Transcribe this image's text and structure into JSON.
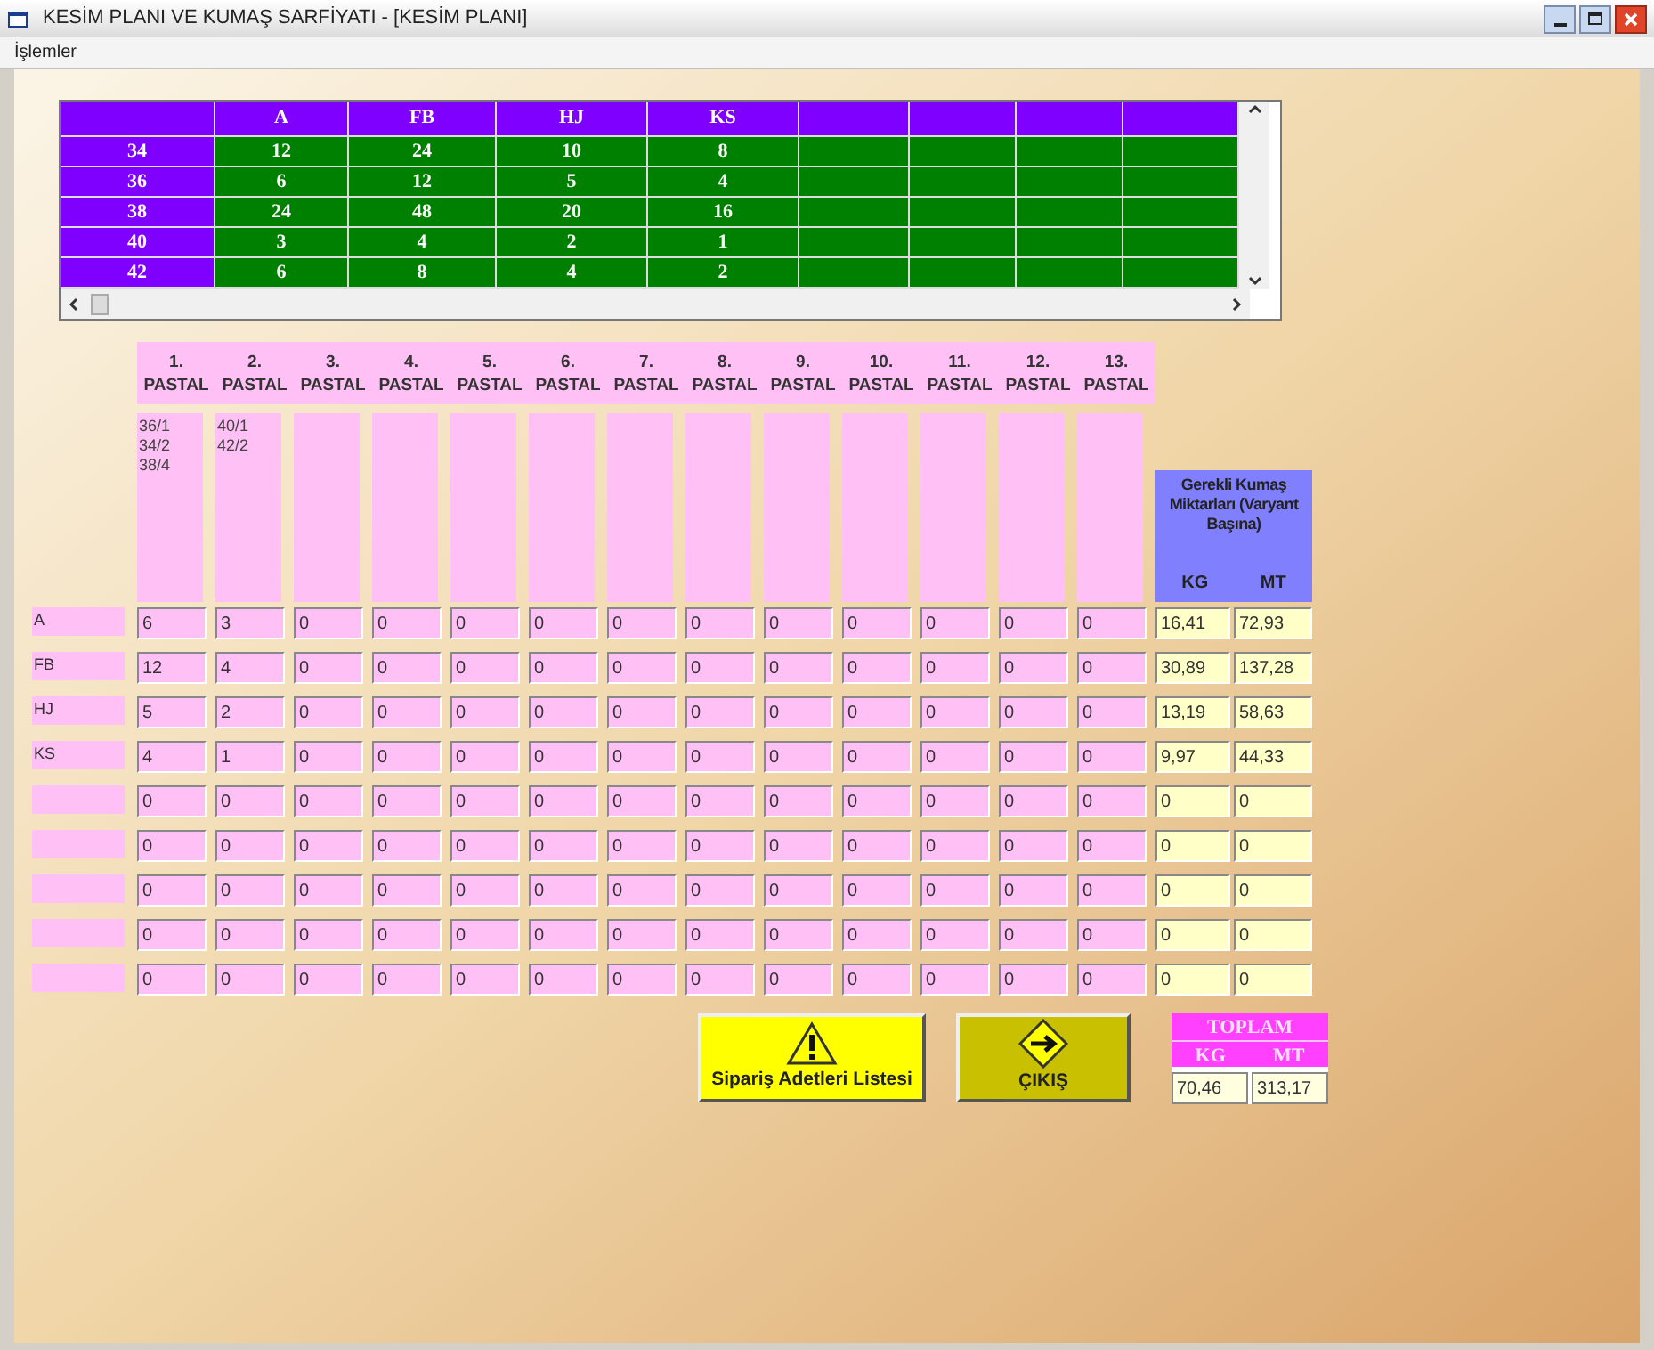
{
  "window": {
    "title": "KESİM PLANI VE KUMAŞ SARFİYATI  - [KESİM PLANI]"
  },
  "menu": [
    "İşlemler"
  ],
  "order_table": {
    "columns": [
      "A",
      "FB",
      "HJ",
      "KS"
    ],
    "rows": [
      {
        "size": "34",
        "values": [
          "12",
          "24",
          "10",
          "8"
        ]
      },
      {
        "size": "36",
        "values": [
          "6",
          "12",
          "5",
          "4"
        ]
      },
      {
        "size": "38",
        "values": [
          "24",
          "48",
          "20",
          "16"
        ]
      },
      {
        "size": "40",
        "values": [
          "3",
          "4",
          "2",
          "1"
        ]
      },
      {
        "size": "42",
        "values": [
          "6",
          "8",
          "4",
          "2"
        ]
      }
    ]
  },
  "pastals": [
    {
      "number": "1.",
      "label": "PASTAL",
      "contents": [
        "36/1",
        "34/2",
        "38/4"
      ]
    },
    {
      "number": "2.",
      "label": "PASTAL",
      "contents": [
        "40/1",
        "42/2"
      ]
    },
    {
      "number": "3.",
      "label": "PASTAL"
    },
    {
      "number": "4.",
      "label": "PASTAL"
    },
    {
      "number": "5.",
      "label": "PASTAL"
    },
    {
      "number": "6.",
      "label": "PASTAL"
    },
    {
      "number": "7.",
      "label": "PASTAL"
    },
    {
      "number": "8.",
      "label": "PASTAL"
    },
    {
      "number": "9.",
      "label": "PASTAL"
    },
    {
      "number": "10.",
      "label": "PASTAL"
    },
    {
      "number": "11.",
      "label": "PASTAL"
    },
    {
      "number": "12.",
      "label": "PASTAL"
    },
    {
      "number": "13.",
      "label": "PASTAL"
    }
  ],
  "fabric_panel": {
    "title": "Gerekli Kumaş Miktarları (Varyant Başına)",
    "kg_label": "KG",
    "mt_label": "MT"
  },
  "variants": [
    {
      "name": "A",
      "amounts": [
        "6",
        "3",
        "0",
        "0",
        "0",
        "0",
        "0",
        "0",
        "0",
        "0",
        "0",
        "0",
        "0"
      ],
      "kg": "16,41",
      "mt": "72,93"
    },
    {
      "name": "FB",
      "amounts": [
        "12",
        "4",
        "0",
        "0",
        "0",
        "0",
        "0",
        "0",
        "0",
        "0",
        "0",
        "0",
        "0"
      ],
      "kg": "30,89",
      "mt": "137,28"
    },
    {
      "name": "HJ",
      "amounts": [
        "5",
        "2",
        "0",
        "0",
        "0",
        "0",
        "0",
        "0",
        "0",
        "0",
        "0",
        "0",
        "0"
      ],
      "kg": "13,19",
      "mt": "58,63"
    },
    {
      "name": "KS",
      "amounts": [
        "4",
        "1",
        "0",
        "0",
        "0",
        "0",
        "0",
        "0",
        "0",
        "0",
        "0",
        "0",
        "0"
      ],
      "kg": "9,97",
      "mt": "44,33"
    },
    {
      "amounts": [
        "0",
        "0",
        "0",
        "0",
        "0",
        "0",
        "0",
        "0",
        "0",
        "0",
        "0",
        "0",
        "0"
      ],
      "kg": "0",
      "mt": "0"
    },
    {
      "amounts": [
        "0",
        "0",
        "0",
        "0",
        "0",
        "0",
        "0",
        "0",
        "0",
        "0",
        "0",
        "0",
        "0"
      ],
      "kg": "0",
      "mt": "0"
    },
    {
      "amounts": [
        "0",
        "0",
        "0",
        "0",
        "0",
        "0",
        "0",
        "0",
        "0",
        "0",
        "0",
        "0",
        "0"
      ],
      "kg": "0",
      "mt": "0"
    },
    {
      "amounts": [
        "0",
        "0",
        "0",
        "0",
        "0",
        "0",
        "0",
        "0",
        "0",
        "0",
        "0",
        "0",
        "0"
      ],
      "kg": "0",
      "mt": "0"
    },
    {
      "amounts": [
        "0",
        "0",
        "0",
        "0",
        "0",
        "0",
        "0",
        "0",
        "0",
        "0",
        "0",
        "0",
        "0"
      ],
      "kg": "0",
      "mt": "0"
    }
  ],
  "buttons": [
    {
      "label": "Sipariş Adetleri Listesi",
      "kind": "warning"
    },
    {
      "label": "ÇIKIŞ",
      "kind": "exit"
    }
  ],
  "total": {
    "title": "TOPLAM",
    "kg_label": "KG",
    "mt_label": "MT",
    "kg": "70,46",
    "mt": "313,17"
  }
}
